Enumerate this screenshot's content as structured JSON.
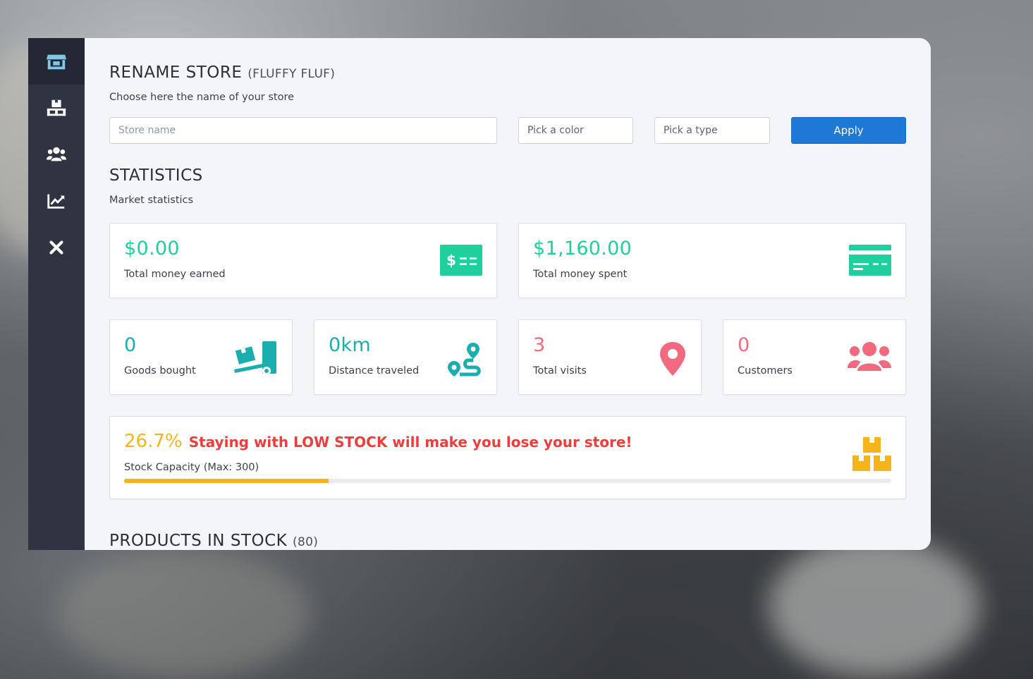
{
  "sidebar": {
    "items": [
      {
        "icon": "store-icon",
        "active": true
      },
      {
        "icon": "warehouse-icon",
        "active": false
      },
      {
        "icon": "users-icon",
        "active": false
      },
      {
        "icon": "chart-icon",
        "active": false
      },
      {
        "icon": "close-icon",
        "active": false
      }
    ]
  },
  "rename": {
    "title": "RENAME STORE",
    "store_name": "(FLUFFY FLUF)",
    "description": "Choose here the name of your store",
    "name_placeholder": "Store name",
    "color_placeholder": "Pick a color",
    "type_placeholder": "Pick a type",
    "apply_label": "Apply"
  },
  "statistics": {
    "title": "STATISTICS",
    "description": "Market statistics",
    "money_earned": {
      "value": "$0.00",
      "label": "Total money earned"
    },
    "money_spent": {
      "value": "$1,160.00",
      "label": "Total money spent"
    },
    "goods_bought": {
      "value": "0",
      "label": "Goods bought"
    },
    "distance": {
      "value": "0km",
      "label": "Distance traveled"
    },
    "visits": {
      "value": "3",
      "label": "Total visits"
    },
    "customers": {
      "value": "0",
      "label": "Customers"
    },
    "stock": {
      "percent": "26.7%",
      "fill_percent": 26.7,
      "warning": "Staying with LOW STOCK will make you lose your store!",
      "label": "Stock Capacity (Max: 300)"
    }
  },
  "products": {
    "title": "PRODUCTS IN STOCK",
    "count": "(80)"
  },
  "colors": {
    "green": "#1fcf9c",
    "teal": "#1aafae",
    "pink": "#f36a7f",
    "orange": "#f4b51c",
    "red": "#ef3d3d",
    "primary": "#1e78d6",
    "sidebar": "#2f3342"
  }
}
